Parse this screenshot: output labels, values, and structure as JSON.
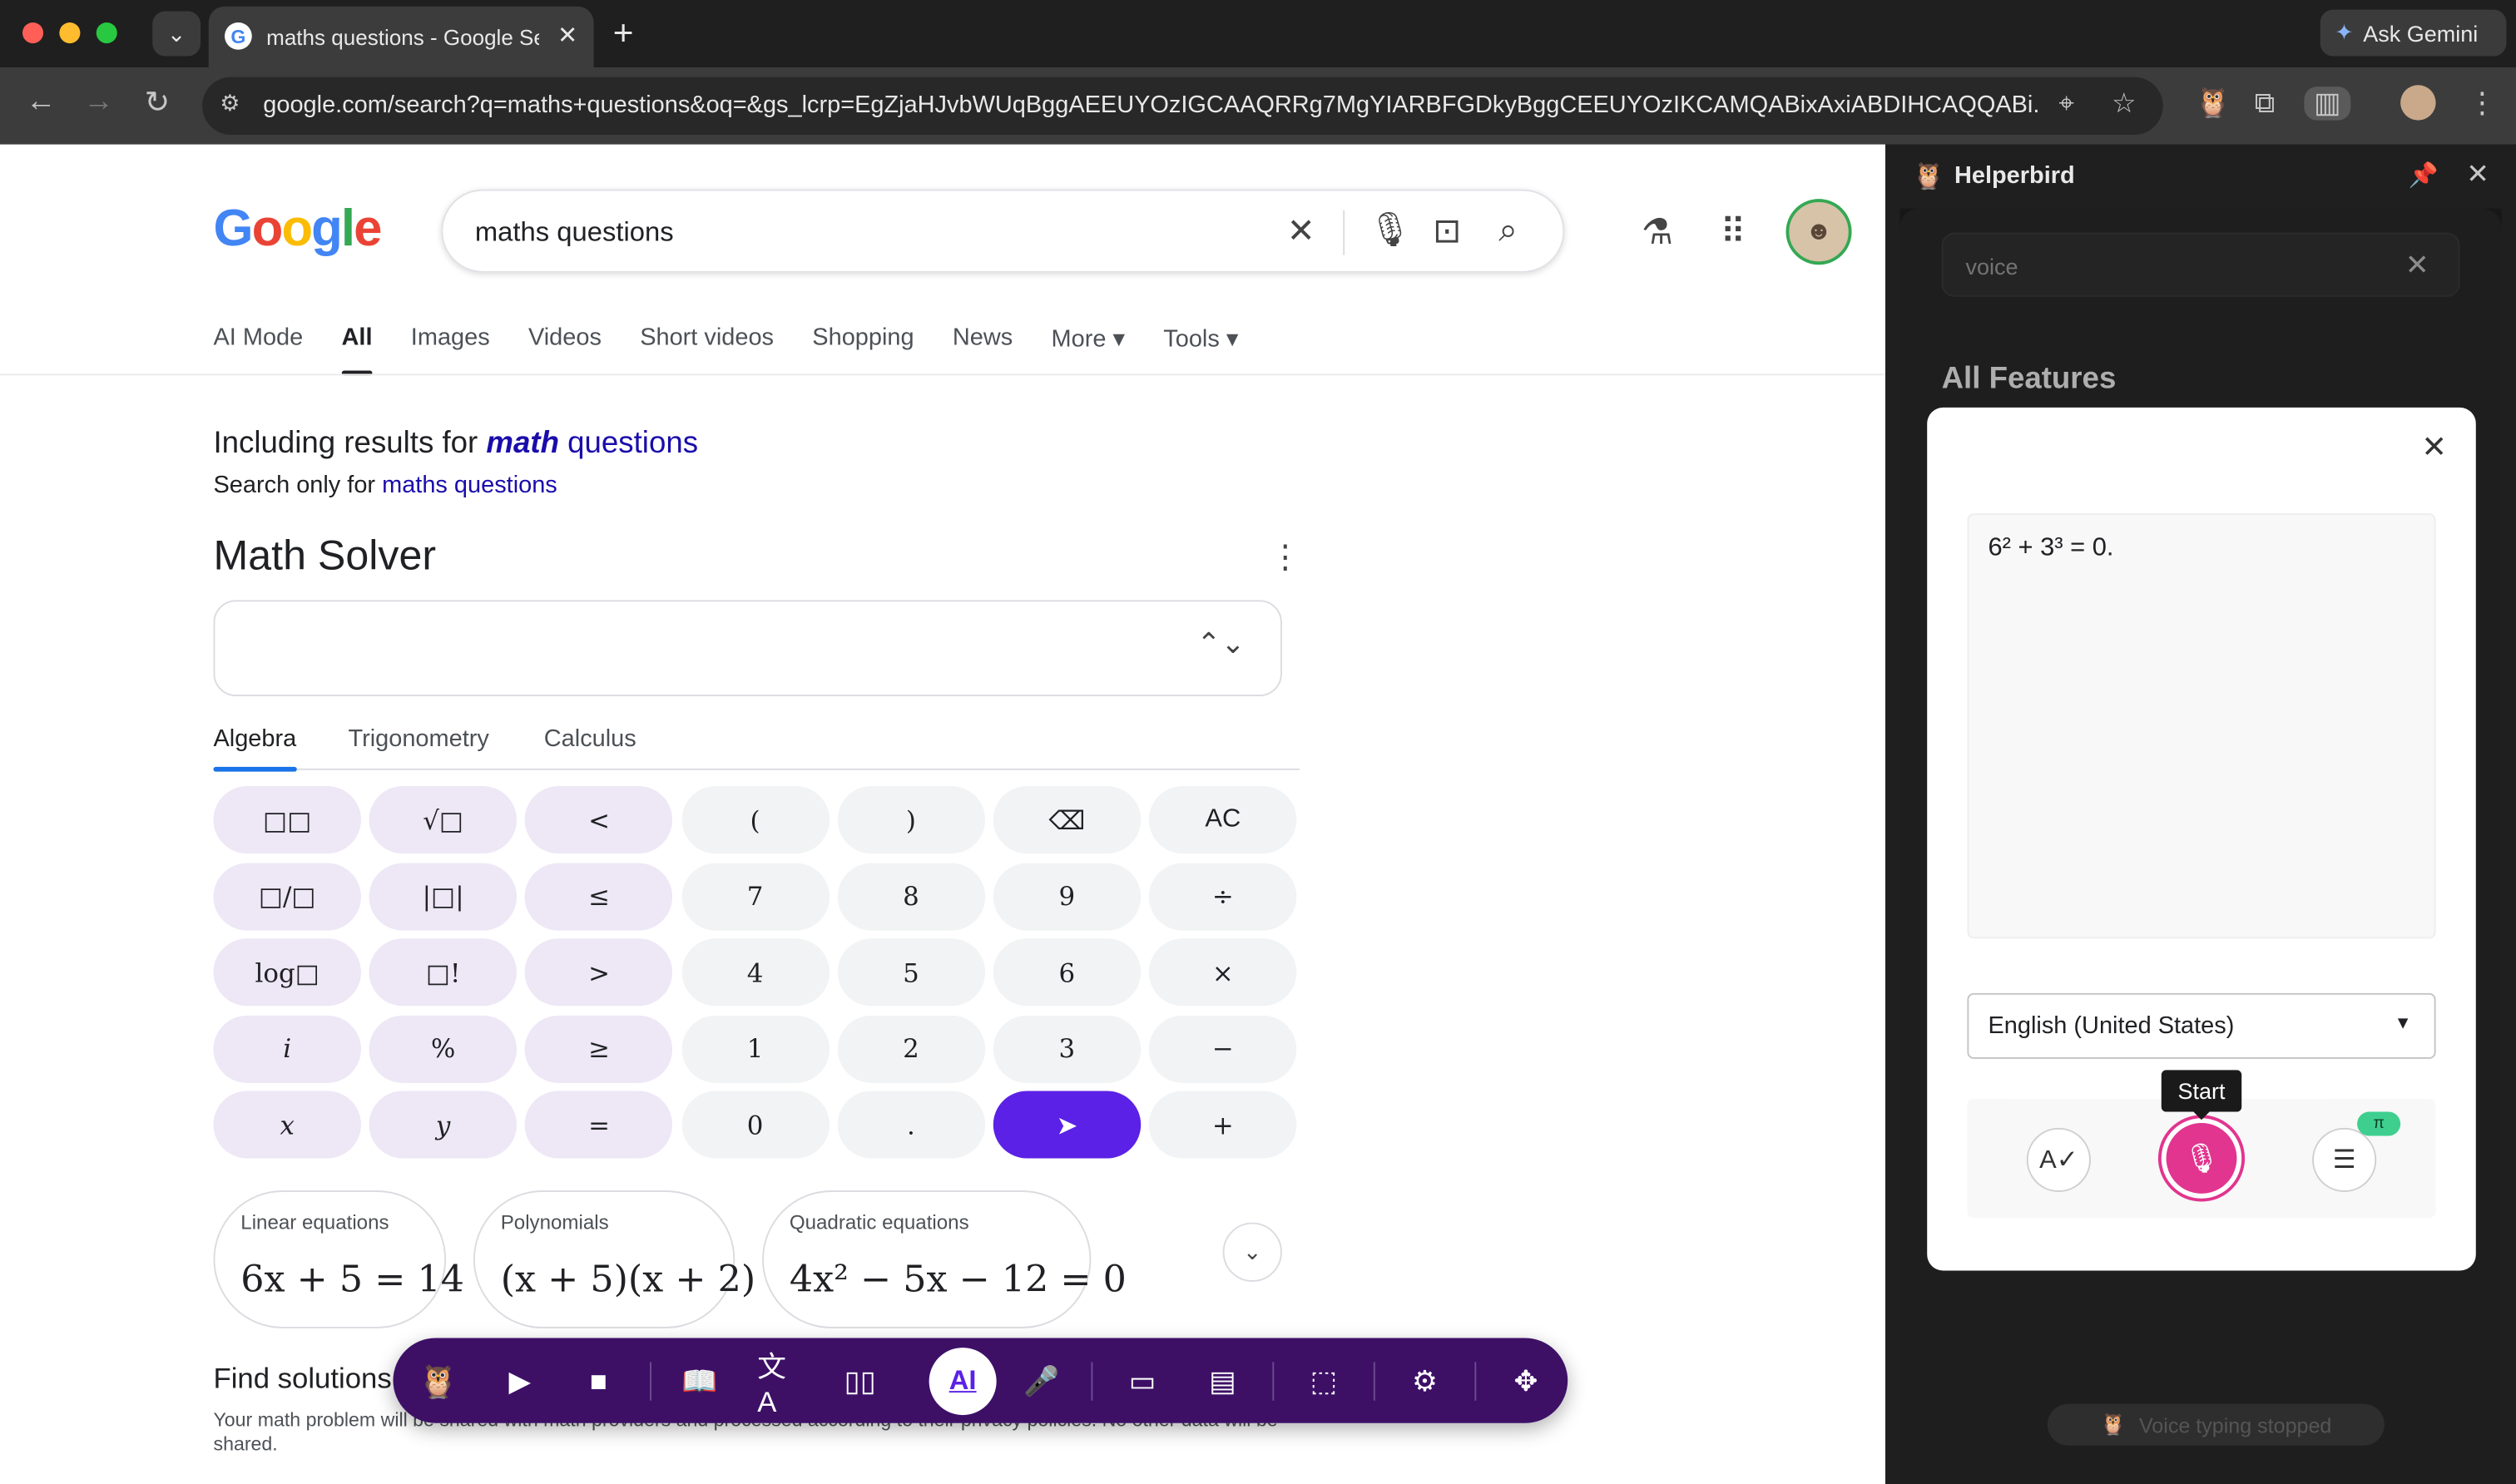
{
  "browser": {
    "tab_title": "maths questions - Google Se",
    "tab_close": "✕",
    "new_tab": "+",
    "ask_gemini": "Ask Gemini",
    "url": "google.com/search?q=maths+questions&oq=&gs_lcrp=EgZjaHJvbWUqBggAEEUYOzIGCAAQRRg7MgYIARBFGDkyBggCEEUYOzIKCAMQABixAxiABDIHCAQQABi..."
  },
  "google": {
    "logo": "Google",
    "query": "maths questions",
    "tabs": [
      "AI Mode",
      "All",
      "Images",
      "Videos",
      "Short videos",
      "Shopping",
      "News",
      "More ▾",
      "Tools ▾"
    ],
    "including_prefix": "Including results for ",
    "including_em": "math",
    "including_suffix": " questions",
    "search_only_prefix": "Search only for ",
    "search_only_link": "maths questions"
  },
  "math_solver": {
    "title": "Math Solver",
    "tabs": [
      "Algebra",
      "Trigonometry",
      "Calculus"
    ],
    "keys": [
      [
        "□□",
        "√□",
        "<",
        "(",
        ")",
        "⌫",
        "AC"
      ],
      [
        "□/□",
        "|□|",
        "≤",
        "7",
        "8",
        "9",
        "÷"
      ],
      [
        "log□",
        "□!",
        ">",
        "4",
        "5",
        "6",
        "×"
      ],
      [
        "i",
        "%",
        "≥",
        "1",
        "2",
        "3",
        "−"
      ],
      [
        "x",
        "y",
        "=",
        "0",
        ".",
        "➤",
        "+"
      ]
    ],
    "examples": [
      {
        "label": "Linear equations",
        "eq": "6x + 5 = 14"
      },
      {
        "label": "Polynomials",
        "eq": "(x + 5)(x + 2)"
      },
      {
        "label": "Quadratic equations",
        "eq": "4x² − 5x − 12 = 0"
      }
    ],
    "find_title": "Find solutions c",
    "find_sub": "Your math problem will be shared with math providers and processed according to their privacy policies. No other data will be shared."
  },
  "side_panel": {
    "title": "Helperbird",
    "search_value": "voice",
    "all_features": "All Features",
    "toast": "Voice typing stopped"
  },
  "voice_modal": {
    "text": "6² + 3³ = 0.",
    "language": "English (United States)",
    "tooltip": "Start",
    "badge": "π"
  },
  "colors": {
    "accent_purple": "#5b21e6",
    "helperbird_bar": "#3d1066",
    "mic_pink": "#e1358f"
  }
}
